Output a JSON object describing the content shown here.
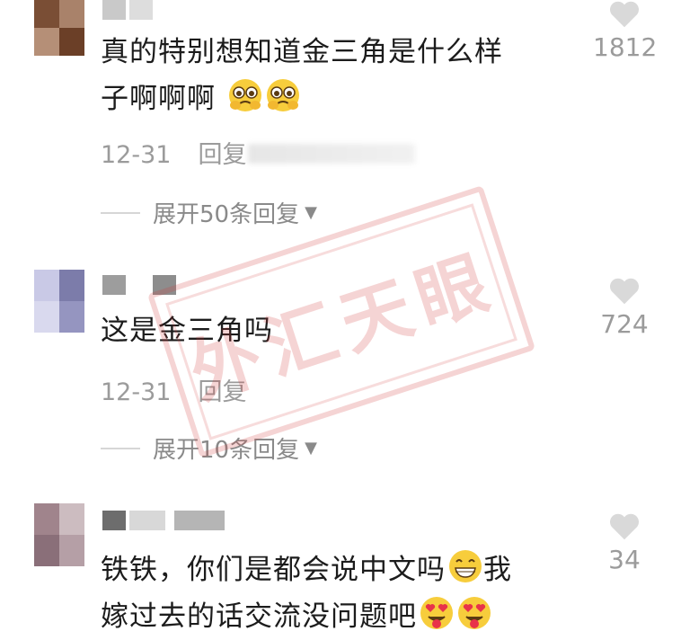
{
  "comments": [
    {
      "text_line1": "真的特别想知道金三角是什么样",
      "text_line2": "子啊啊啊",
      "date": "12-31",
      "reply_label": "回复",
      "expand_label": "展开50条回复",
      "likes": "1812",
      "emoji": "pleading-face"
    },
    {
      "text_line1": "这是金三角吗",
      "date": "12-31",
      "reply_label": "回复",
      "expand_label": "展开10条回复",
      "likes": "724"
    },
    {
      "text_line1": "铁铁，你们是都会说中文吗",
      "text_line1b": "我",
      "text_line2": "嫁过去的话交流没问题吧",
      "likes": "34",
      "emoji_a": "grinning-face",
      "emoji_b": "heart-eyes-tongue-face"
    }
  ],
  "watermark": "外汇天眼",
  "colors": {
    "like_icon": "#d9d9d9",
    "meta_text": "#9b9b9b",
    "watermark": "#d23c3c",
    "emoji_yellow": "#f7cd3c"
  }
}
